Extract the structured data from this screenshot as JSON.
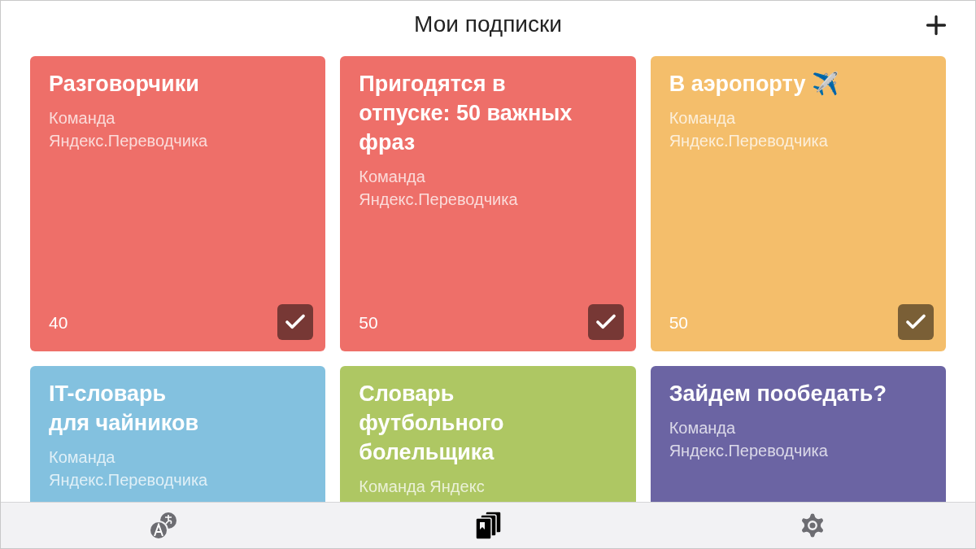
{
  "header": {
    "title": "Мои подписки"
  },
  "cards": [
    {
      "title": "Разговорчики",
      "author": "Команда\nЯндекс.Переводчика",
      "count": "40",
      "subscribed": true,
      "color": "#ee6f69"
    },
    {
      "title": "Пригодятся в\nотпуске: 50 важных\nфраз",
      "author": "Команда\nЯндекс.Переводчика",
      "count": "50",
      "subscribed": true,
      "color": "#ee6f69"
    },
    {
      "title": "В аэропорту ✈️",
      "author": "Команда\nЯндекс.Переводчика",
      "count": "50",
      "subscribed": true,
      "color": "#f4be6b"
    },
    {
      "title": "IT-словарь\nдля чайников",
      "author": "Команда\nЯндекс.Переводчика",
      "color": "#83c1df"
    },
    {
      "title": "Словарь\nфутбольного\nболельщика",
      "author": "Команда Яндекс",
      "color": "#aec763"
    },
    {
      "title": "Зайдем пообедать?",
      "author": "Команда\nЯндекс.Переводчика",
      "color": "#6b64a3"
    }
  ],
  "tabs": [
    {
      "kind": "translate",
      "selected": false
    },
    {
      "kind": "collections",
      "selected": true
    },
    {
      "kind": "settings",
      "selected": false
    }
  ]
}
